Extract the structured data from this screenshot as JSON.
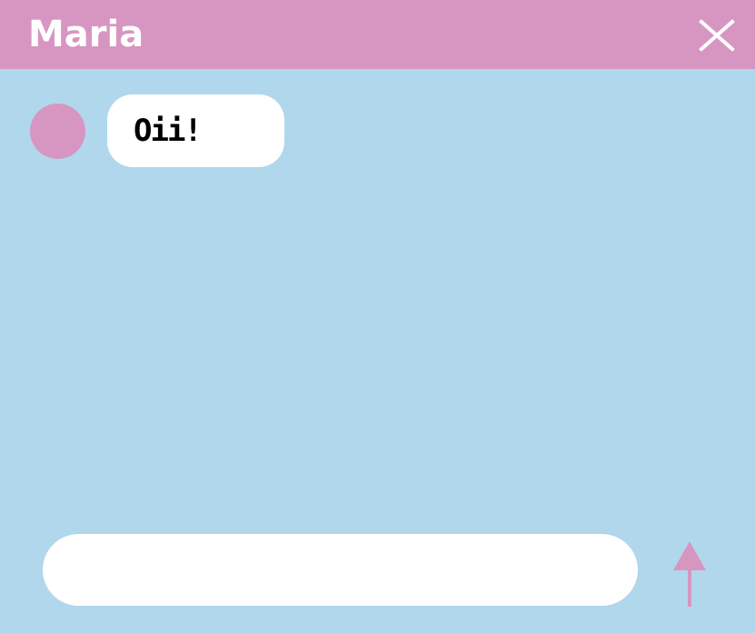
{
  "window": {
    "title": "Maria",
    "close_icon": "close-icon"
  },
  "messages": [
    {
      "sender": "Maria",
      "text": "Oii!"
    }
  ],
  "composer": {
    "value": "",
    "placeholder": "",
    "send_icon": "arrow-up-icon"
  },
  "colors": {
    "header": "#D796C1",
    "background": "#B1D7EC",
    "bubble": "#FFFFFF",
    "accent": "#D796C1"
  }
}
